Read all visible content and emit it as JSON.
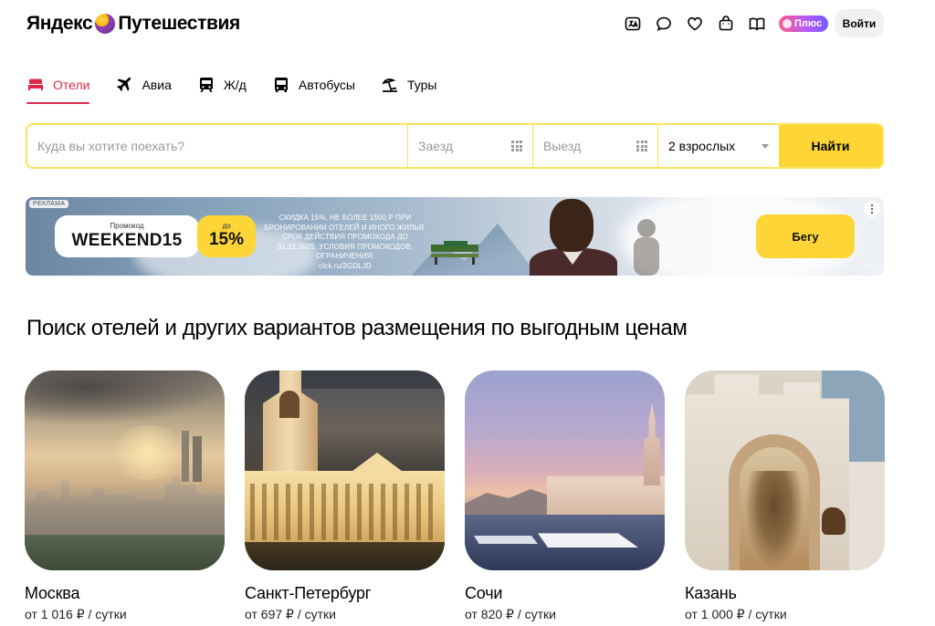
{
  "header": {
    "logo": {
      "part1": "Яндекс",
      "part2": "Путешествия"
    },
    "icons": [
      "translate-icon",
      "chat-icon",
      "heart-icon",
      "bag-icon",
      "book-icon"
    ],
    "plus_label": "Плюс",
    "login_label": "Войти"
  },
  "tabs": [
    {
      "label": "Отели",
      "icon": "bed-icon",
      "active": true
    },
    {
      "label": "Авиа",
      "icon": "plane-icon",
      "active": false
    },
    {
      "label": "Ж/д",
      "icon": "train-icon",
      "active": false
    },
    {
      "label": "Автобусы",
      "icon": "bus-icon",
      "active": false
    },
    {
      "label": "Туры",
      "icon": "beach-icon",
      "active": false
    }
  ],
  "search": {
    "destination_placeholder": "Куда вы хотите поехать?",
    "checkin_placeholder": "Заезд",
    "checkout_placeholder": "Выезд",
    "guests_value": "2 взрослых",
    "submit_label": "Найти"
  },
  "ad": {
    "label": "РЕКЛАМА",
    "promo_label": "Промокод",
    "promo_code": "WEEKEND15",
    "discount_prefix": "до",
    "discount_value": "15%",
    "terms": "СКИДКА 15%, НЕ БОЛЕЕ 1500 Р ПРИ БРОНИРОВАНИИ ОТЕЛЕЙ И ИНОГО ЖИЛЬЯ. СРОК ДЕЙСТВИЯ ПРОМОКОДА ДО 31.12.2025. УСЛОВИЯ ПРОМОКОДОВ, ОГРАНИЧЕНИЯ:",
    "terms_link": "clck.ru/3GDLJD",
    "button_label": "Бегу",
    "age": "0+"
  },
  "section_title": "Поиск отелей и других вариантов размещения по выгодным ценам",
  "cities": [
    {
      "name": "Москва",
      "price": "от 1 016 ₽ / сутки"
    },
    {
      "name": "Санкт-Петербург",
      "price": "от 697 ₽ / сутки"
    },
    {
      "name": "Сочи",
      "price": "от 820 ₽ / сутки"
    },
    {
      "name": "Казань",
      "price": "от 1 000 ₽ / сутки"
    }
  ],
  "colors": {
    "accent_red": "#e0294a",
    "brand_yellow": "#fdd536",
    "search_border": "#fde25a"
  }
}
